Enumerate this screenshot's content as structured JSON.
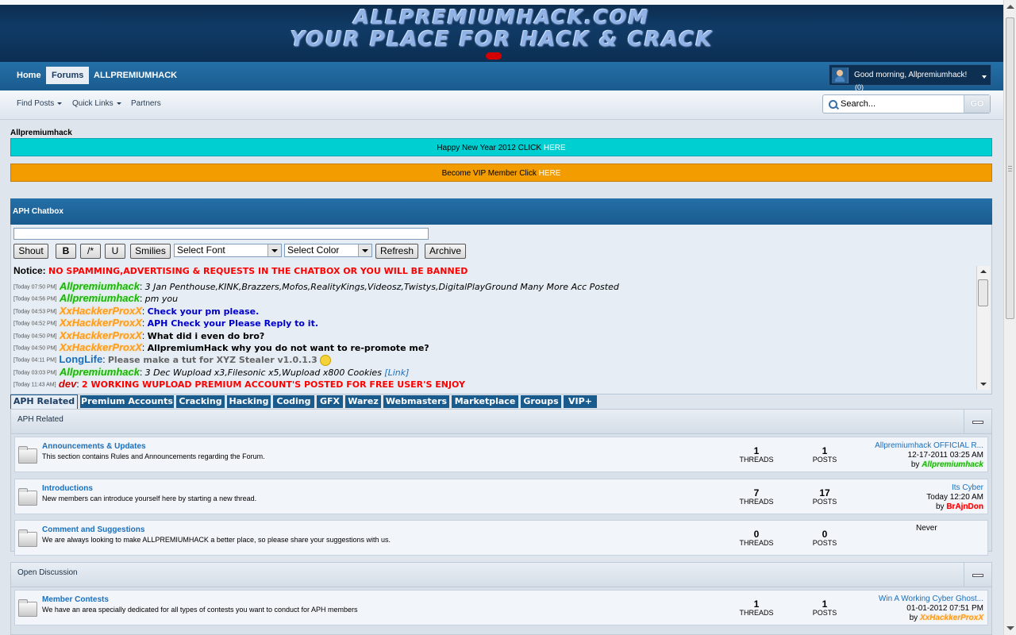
{
  "header": {
    "logo_line1": "ALLPREMIUMHACK.COM",
    "logo_line2": "YOUR PLACE FOR HACK & CRACK"
  },
  "nav": {
    "tabs": [
      {
        "label": "Home"
      },
      {
        "label": "Forums"
      },
      {
        "label": "ALLPREMIUMHACK"
      }
    ],
    "active_tab": "Forums",
    "welcome": "Good morning, Allpremiumhack!",
    "notifications": "(0)"
  },
  "subnav": {
    "links": [
      {
        "label": "Find Posts",
        "dropdown": true
      },
      {
        "label": "Quick Links",
        "dropdown": true
      },
      {
        "label": "Partners",
        "dropdown": false
      }
    ],
    "search_placeholder": "Search...",
    "search_go": "GO"
  },
  "site_name": "Allpremiumhack",
  "banners": [
    {
      "text": "Happy New Year 2012 CLICK ",
      "link": "HERE",
      "bg": "#00cfd1"
    },
    {
      "text": "Become VIP Member Click ",
      "link": "HERE",
      "bg": "#f29c00"
    }
  ],
  "chatbox": {
    "title": "APH Chatbox",
    "buttons": {
      "shout": "Shout",
      "bold": "B",
      "italic": "/*",
      "underline": "U",
      "smilies": "Smilies",
      "refresh": "Refresh",
      "archive": "Archive"
    },
    "font_select": "Select Font",
    "color_select": "Select Color",
    "notice_label": "Notice:",
    "notice_text": "NO SPAMMING,ADVERTISING & REQUESTS IN THE CHATBOX OR YOU WILL BE BANNED",
    "messages": [
      {
        "time": "[Today 07:50 PM]",
        "user": "Allpremiumhack",
        "user_style": "green",
        "text": "3 Jan Penthouse,KINK,Brazzers,Mofos,RealityKings,Videosz,Twistys,DigitalPlayGround Many More Acc Posted",
        "text_style": "it"
      },
      {
        "time": "[Today 04:56 PM]",
        "user": "Allpremiumhack",
        "user_style": "green",
        "text": "pm you",
        "text_style": "it"
      },
      {
        "time": "[Today 04:53 PM]",
        "user": "XxHackkerProxX",
        "user_style": "orange",
        "text": "Check your pm please.",
        "text_style": "bb"
      },
      {
        "time": "[Today 04:52 PM]",
        "user": "XxHackkerProxX",
        "user_style": "orange",
        "text": "APH Check your Please Reply to it.",
        "text_style": "bb"
      },
      {
        "time": "[Today 04:50 PM]",
        "user": "XxHackkerProxX",
        "user_style": "orange",
        "text": "What did i even do bro?",
        "text_style": "bk"
      },
      {
        "time": "[Today 04:50 PM]",
        "user": "XxHackkerProxX",
        "user_style": "orange",
        "text": "AllpremiumHack why you do not want to re-promote me?",
        "text_style": "bk"
      },
      {
        "time": "[Today 04:11 PM]",
        "user": "LongLife",
        "user_style": "blue",
        "text": "Please make a tut for XYZ Stealer v1.0.1.3",
        "text_style": "gr",
        "smiley": true
      },
      {
        "time": "[Today 03:03 PM]",
        "user": "Allpremiumhack",
        "user_style": "green",
        "text": "3 Dec Wupload x3,Filesonic x5,Wupload x800 Cookies",
        "text_style": "it",
        "link": "[Link]"
      },
      {
        "time": "[Today 11:43 AM]",
        "user": "dev",
        "user_style": "red",
        "text": "2 WORKING WUPLOAD PREMIUM ACCOUNT'S POSTED FOR FREE USER'S ENJOY",
        "text_style": "rd"
      }
    ]
  },
  "category_tabs": [
    "APH Related",
    "Premium Accounts",
    "Cracking",
    "Hacking",
    "Coding",
    "GFX",
    "Warez",
    "Webmasters",
    "Marketplace",
    "Groups",
    "VIP+"
  ],
  "categories": [
    {
      "title": "APH Related",
      "forums": [
        {
          "name": "Announcements & Updates",
          "desc": "This section contains Rules and Announcements regarding the Forum.",
          "threads": "1",
          "posts": "1",
          "threads_label": "THREADS",
          "posts_label": "POSTS",
          "last_title": "Allpremiumhack OFFICIAL R...",
          "last_date": "12-17-2011 03:25 AM",
          "by": "by",
          "last_user": "Allpremiumhack",
          "user_style": "green"
        },
        {
          "name": "Introductions",
          "desc": "New members can introduce yourself here by starting a new thread.",
          "threads": "7",
          "posts": "17",
          "threads_label": "THREADS",
          "posts_label": "POSTS",
          "last_title": "Its Cyber",
          "last_date": "Today 12:20 AM",
          "by": "by",
          "last_user": "BrAjnDon",
          "user_style": "red"
        },
        {
          "name": "Comment and Suggestions",
          "desc": "We are always looking to make ALLPREMIUMHACK a better place, so please share your suggestions with us.",
          "threads": "0",
          "posts": "0",
          "threads_label": "THREADS",
          "posts_label": "POSTS",
          "never": "Never"
        }
      ]
    },
    {
      "title": "Open Discussion",
      "forums": [
        {
          "name": "Member Contests",
          "desc": "We have an area specially dedicated for all types of contests you want to conduct for APH members",
          "threads": "1",
          "posts": "1",
          "threads_label": "THREADS",
          "posts_label": "POSTS",
          "last_title": "Win A Working Cyber Ghost...",
          "last_date": "01-01-2012 07:51 PM",
          "by": "by",
          "last_user": "XxHackkerProxX",
          "user_style": "orange"
        }
      ]
    }
  ]
}
